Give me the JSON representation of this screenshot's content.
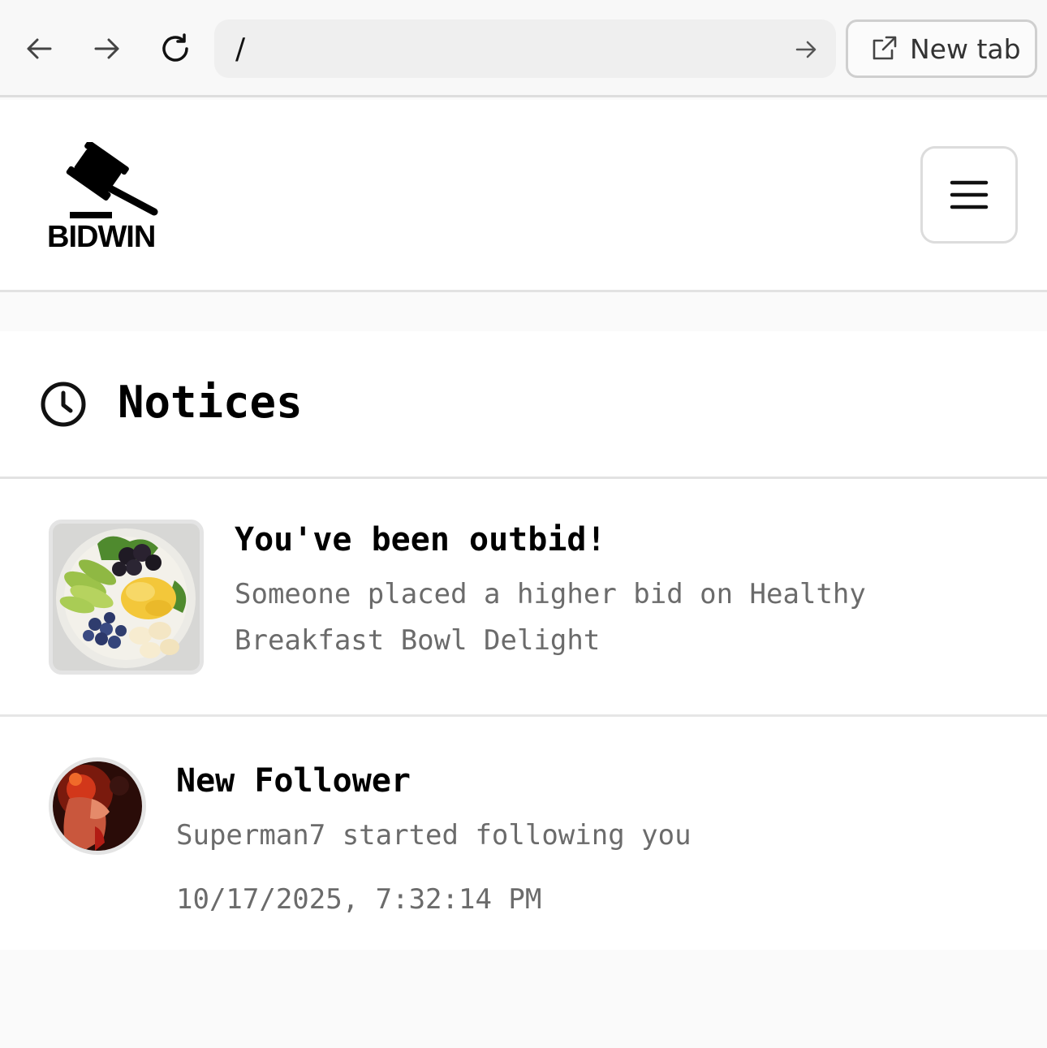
{
  "browser": {
    "url": "/",
    "new_tab_label": "New tab"
  },
  "app": {
    "logo_text": "BIDWIN"
  },
  "notices": {
    "title": "Notices",
    "items": [
      {
        "title": "You've been outbid!",
        "message": "Someone placed a higher bid on Healthy Breakfast Bowl Delight",
        "image": "breakfast-bowl-thumbnail"
      },
      {
        "title": "New Follower",
        "message": "Superman7 started following you",
        "timestamp": "10/17/2025, 7:32:14 PM",
        "image": "user-avatar"
      }
    ]
  },
  "icons": {
    "back": "arrow-left-icon",
    "forward": "arrow-right-icon",
    "reload": "reload-icon",
    "go": "arrow-right-icon",
    "new_tab": "external-link-icon",
    "menu": "hamburger-icon",
    "notices": "clock-icon"
  }
}
